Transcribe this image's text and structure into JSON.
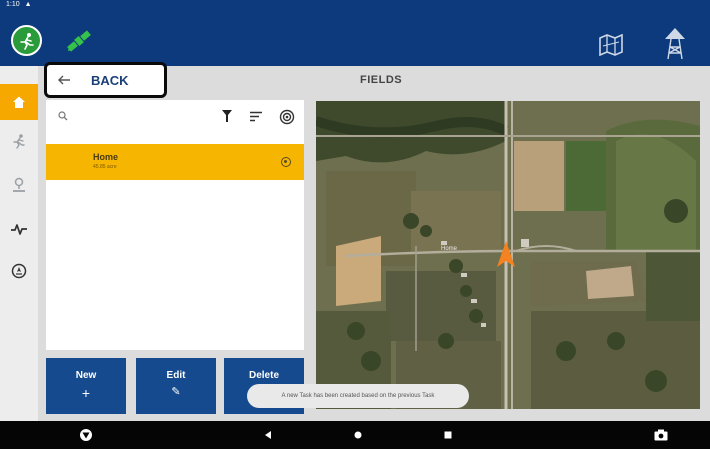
{
  "status_bar": {
    "time": "1:10",
    "notification_icon": "warning-icon"
  },
  "top_bar": {
    "logo_icon": "runner-icon",
    "logo_color": "#2a9b3a",
    "gps_icon": "satellite-icon",
    "gps_color": "#35c24a",
    "right_icons": [
      "field-map-icon",
      "tower-icon"
    ],
    "bar_color": "#0c3a7c"
  },
  "side_nav": {
    "items": [
      {
        "icon": "home-icon",
        "active": true
      },
      {
        "icon": "vehicle-icon",
        "active": false
      },
      {
        "icon": "operator-icon",
        "active": false
      },
      {
        "icon": "diagnostics-icon",
        "active": false
      },
      {
        "icon": "compass-icon",
        "active": false
      }
    ],
    "active_color": "#f6a800"
  },
  "header": {
    "back_label": "BACK",
    "title": "FIELDS"
  },
  "list": {
    "search_icon": "search-icon",
    "toolbar_icons": [
      "filter-icon",
      "sort-icon",
      "target-icon"
    ],
    "items": [
      {
        "name": "Home",
        "subtitle": "45.85 acre",
        "selected": true
      }
    ],
    "selected_color": "#f6b500"
  },
  "actions": {
    "new_label": "New",
    "new_glyph": "+",
    "edit_label": "Edit",
    "edit_glyph": "✎",
    "delete_label": "Delete"
  },
  "map": {
    "marker_label": "Home",
    "marker_color": "#f58220"
  },
  "toast": {
    "text": "A new Task has been created based on the previous Task"
  },
  "system_nav": {
    "icons": [
      "brand-logo-icon",
      "back-triangle-icon",
      "home-dot-icon",
      "recents-square-icon",
      "camera-icon"
    ]
  }
}
